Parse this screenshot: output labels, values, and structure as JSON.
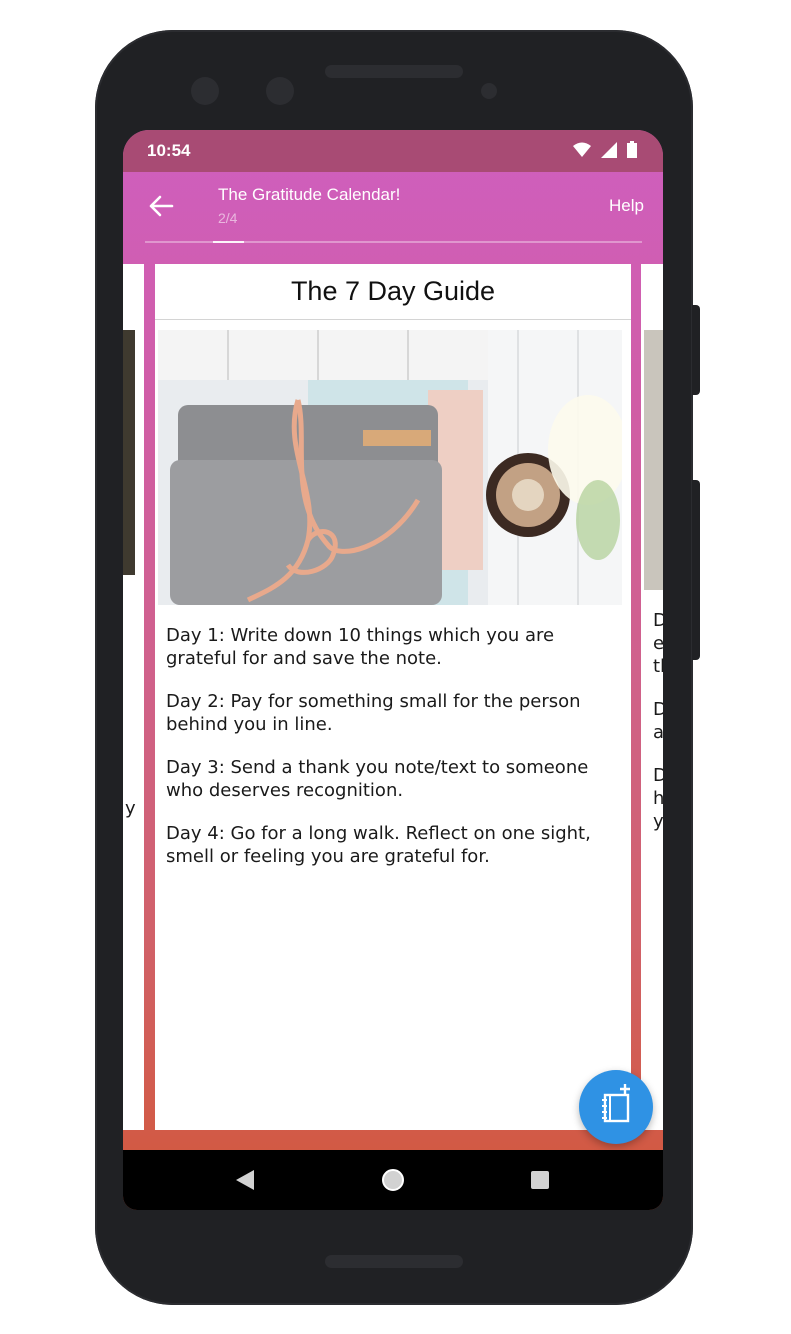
{
  "status_bar": {
    "time": "10:54",
    "icons": [
      "wifi-icon",
      "signal-icon",
      "battery-icon"
    ]
  },
  "app_bar": {
    "title": "The Gratitude Calendar!",
    "subtitle": "2/4",
    "help_label": "Help",
    "progress": 0.25
  },
  "card": {
    "heading": "The 7 Day Guide",
    "image": "rolled-felt-notebook-with-cord-and-plant",
    "paragraphs": [
      "Day 1: Write down 10 things which you are grateful for and save the note.",
      "Day 2: Pay for something small for the person behind you in line.",
      "Day 3: Send a thank you note/text to someone who deserves recognition.",
      "Day 4: Go for a long walk. Reflect on one sight, smell or feeling you are grateful for."
    ]
  },
  "right_card_snippets": [
    "D",
    "e",
    "tl",
    "D",
    "a",
    "D",
    "h",
    "y"
  ],
  "left_card_snippet": "y",
  "colors": {
    "status_bar": "#a84b74",
    "gradient_top": "#cf5fbf",
    "gradient_bottom": "#d2583a",
    "fab": "#2f92e4"
  }
}
